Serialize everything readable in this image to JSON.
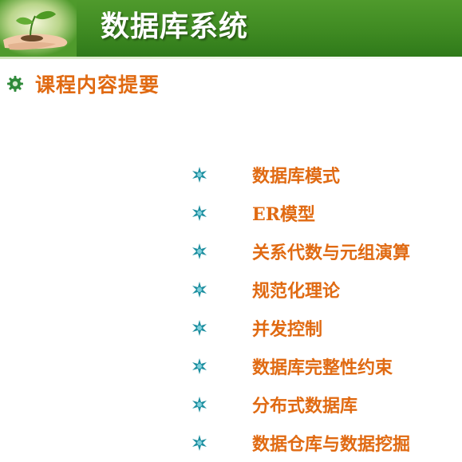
{
  "header": {
    "title": "数据库系统"
  },
  "section": {
    "title": "课程内容提要"
  },
  "topics": [
    "数据库模式",
    "ER模型",
    "关系代数与元组演算",
    "规范化理论",
    "并发控制",
    "数据库完整性约束",
    "分布式数据库",
    "数据仓库与数据挖掘"
  ],
  "icons": {
    "header_art": "seedling-in-hands-icon",
    "section_bullet": "gear-bullet-icon",
    "topic_bullet": "star-bullet-icon"
  },
  "colors": {
    "header_green": "#3f8a22",
    "accent_orange": "#e06a12",
    "section_bullet": "#2f8a3a",
    "topic_bullet": "#1e8fa0"
  }
}
